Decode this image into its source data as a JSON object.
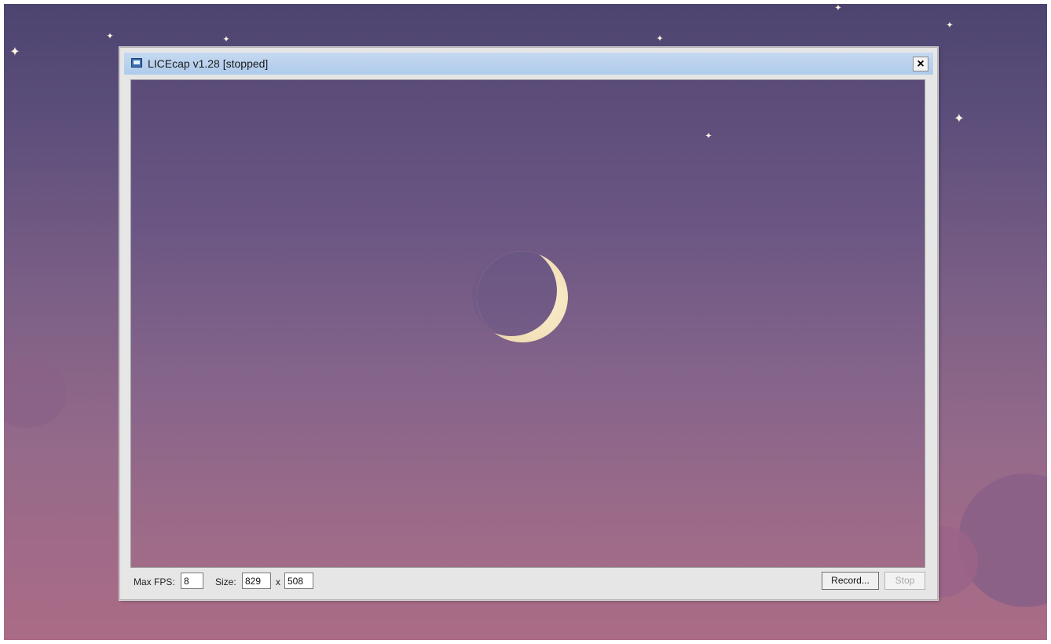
{
  "window": {
    "title": "LICEcap v1.28 [stopped]",
    "close_label": "×"
  },
  "controls": {
    "max_fps_label": "Max FPS:",
    "max_fps_value": "8",
    "size_label": "Size:",
    "width_value": "829",
    "x_label": "x",
    "height_value": "508",
    "record_label": "Record...",
    "stop_label": "Stop"
  },
  "icons": {
    "app": "licecap-app-icon",
    "close": "close-icon",
    "moon": "crescent-moon",
    "stars": "sparkle-star"
  },
  "colors": {
    "title_bar": "#b9d1ee",
    "sky_top": "#4d4470",
    "sky_bottom": "#ab6b86",
    "moon": "#f1dcb3"
  }
}
